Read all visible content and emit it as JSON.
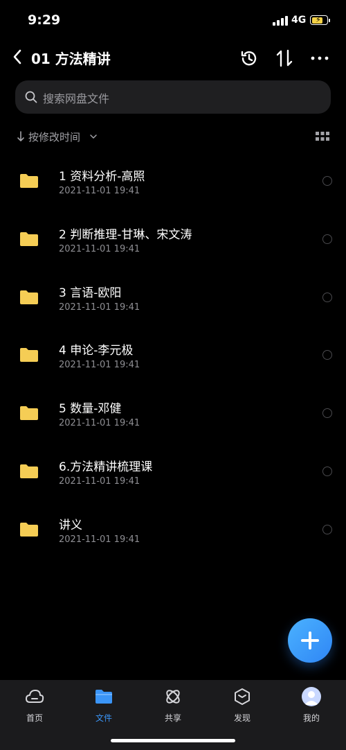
{
  "status": {
    "time": "9:29",
    "network": "4G"
  },
  "header": {
    "title": "01 方法精讲"
  },
  "search": {
    "placeholder": "搜索网盘文件"
  },
  "sort": {
    "label": "按修改时间"
  },
  "files": [
    {
      "name": "1 资料分析-高照",
      "date": "2021-11-01 19:41"
    },
    {
      "name": "2 判断推理-甘琳、宋文涛",
      "date": "2021-11-01 19:41"
    },
    {
      "name": "3 言语-欧阳",
      "date": "2021-11-01 19:41"
    },
    {
      "name": "4 申论-李元极",
      "date": "2021-11-01 19:41"
    },
    {
      "name": "5 数量-邓健",
      "date": "2021-11-01 19:41"
    },
    {
      "name": "6.方法精讲梳理课",
      "date": "2021-11-01 19:41"
    },
    {
      "name": "讲义",
      "date": "2021-11-01 19:41"
    }
  ],
  "tabs": [
    {
      "label": "首页",
      "icon": "cloud-icon"
    },
    {
      "label": "文件",
      "icon": "folder-icon"
    },
    {
      "label": "共享",
      "icon": "share-icon"
    },
    {
      "label": "发现",
      "icon": "discover-icon"
    },
    {
      "label": "我的",
      "icon": "avatar"
    }
  ],
  "colors": {
    "accent": "#3b95f7",
    "folder": "#f5cd55",
    "fab": "#3a9bfb"
  }
}
